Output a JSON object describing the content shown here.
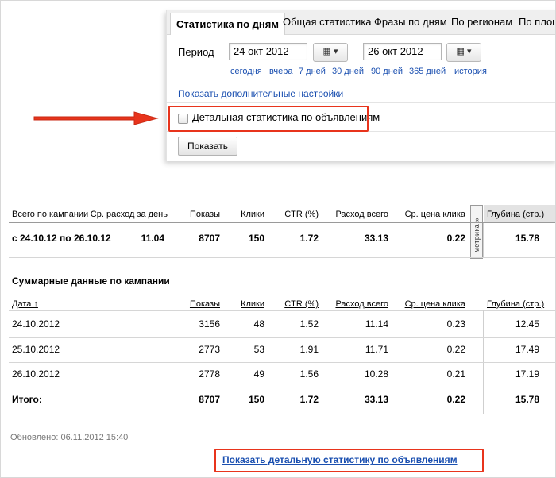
{
  "tabs": [
    {
      "label": "Статистика по дням",
      "active": true
    },
    {
      "label": "Общая статистика",
      "active": false
    },
    {
      "label": "Фразы по дням",
      "active": false
    },
    {
      "label": "По регионам",
      "active": false
    },
    {
      "label": "По площ",
      "active": false
    }
  ],
  "filter": {
    "period_label": "Период",
    "date_from": "24 окт 2012",
    "date_to": "26 окт 2012",
    "dash": "—",
    "calendar_glyph": "▦ ▾",
    "quick_ranges": [
      "сегодня",
      "вчера",
      "7 дней",
      "30 дней",
      "90 дней",
      "365 дней"
    ],
    "history_label": "история",
    "more_settings": "Показать дополнительные настройки",
    "detail_checkbox_label": "Детальная статистика по объявлениям",
    "detail_checkbox_checked": false,
    "show_button": "Показать"
  },
  "summary": {
    "headers": [
      "Всего по кампании",
      "Ср. расход за день",
      "Показы",
      "Клики",
      "CTR (%)",
      "Расход всего",
      "Ср. цена клика",
      "Глубина (стр.)"
    ],
    "metrika_label": "метрика »",
    "row": [
      "с 24.10.12 по 26.10.12",
      "11.04",
      "8707",
      "150",
      "1.72",
      "33.13",
      "0.22",
      "15.78"
    ]
  },
  "daily": {
    "title": "Суммарные данные по кампании",
    "headers": [
      "Дата ↑",
      "Показы",
      "Клики",
      "CTR (%)",
      "Расход всего",
      "Ср. цена клика",
      "Глубина (стр.)"
    ],
    "rows": [
      [
        "24.10.2012",
        "3156",
        "48",
        "1.52",
        "11.14",
        "0.23",
        "12.45"
      ],
      [
        "25.10.2012",
        "2773",
        "53",
        "1.91",
        "11.71",
        "0.22",
        "17.49"
      ],
      [
        "26.10.2012",
        "2778",
        "49",
        "1.56",
        "10.28",
        "0.21",
        "17.19"
      ]
    ],
    "total": [
      "Итого:",
      "8707",
      "150",
      "1.72",
      "33.13",
      "0.22",
      "15.78"
    ]
  },
  "updated": "Обновлено: 06.11.2012 15:40",
  "detail_link": "Показать детальную статистику по объявлениям",
  "colors": {
    "accent_link": "#1a4fb0",
    "highlight": "#e8341c"
  }
}
